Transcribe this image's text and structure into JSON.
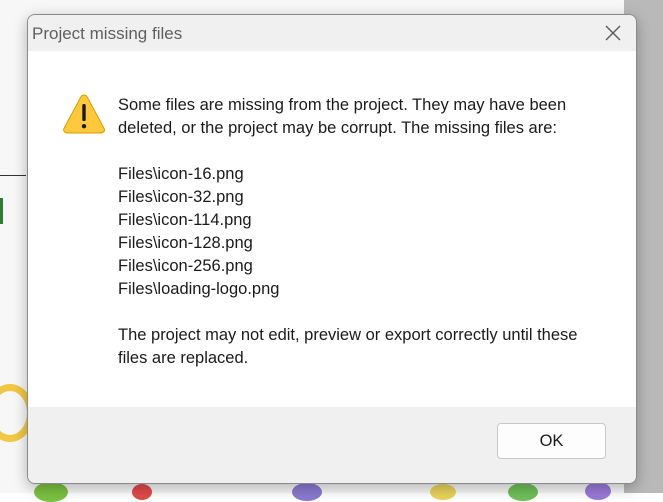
{
  "dialog": {
    "title": "Project missing files",
    "close_icon": "close-icon",
    "warning_icon": "warning-icon",
    "message_intro": "Some files are missing from the project. They may have been deleted, or the project may be corrupt. The missing files are:",
    "missing_files": [
      "Files\\icon-16.png",
      "Files\\icon-32.png",
      "Files\\icon-114.png",
      "Files\\icon-128.png",
      "Files\\icon-256.png",
      "Files\\loading-logo.png"
    ],
    "message_outro": "The project may not edit, preview or export correctly until these files are replaced.",
    "ok_label": "OK"
  },
  "colors": {
    "warning_fill": "#FFC83D",
    "warning_mark": "#1a1a1a",
    "dialog_chrome": "#f0f0f0",
    "content_bg": "#ffffff"
  }
}
